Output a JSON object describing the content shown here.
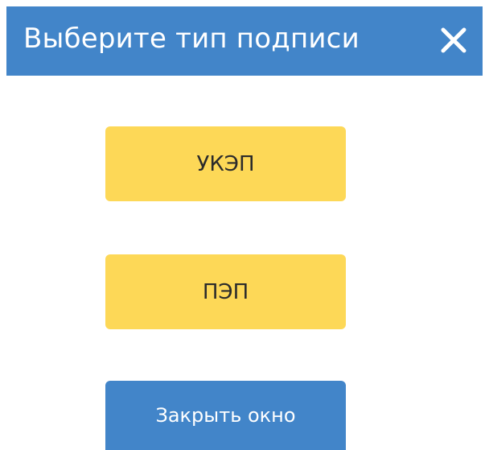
{
  "dialog": {
    "title": "Выберите тип подписи",
    "close_icon": "close-icon"
  },
  "buttons": {
    "ukep_label": "УКЭП",
    "pep_label": "ПЭП",
    "close_label": "Закрыть окно"
  },
  "colors": {
    "header_bg": "#4285c9",
    "primary_button": "#4285c9",
    "option_button": "#fdd857",
    "header_text": "#ffffff",
    "option_text": "#2b2b2b"
  }
}
